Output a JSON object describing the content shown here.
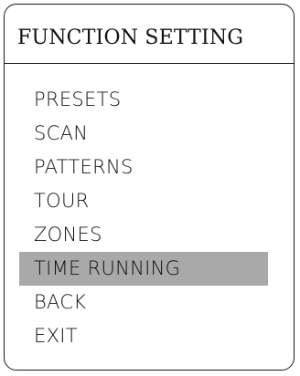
{
  "title": "FUNCTION SETTING",
  "items": [
    {
      "label": "PRESETS",
      "selected": false
    },
    {
      "label": "SCAN",
      "selected": false
    },
    {
      "label": "PATTERNS",
      "selected": false
    },
    {
      "label": "TOUR",
      "selected": false
    },
    {
      "label": "ZONES",
      "selected": false
    },
    {
      "label": "TIME RUNNING",
      "selected": true
    },
    {
      "label": "BACK",
      "selected": false
    },
    {
      "label": "EXIT",
      "selected": false
    }
  ],
  "colors": {
    "highlight": "#a9a9a9",
    "border": "#1a1a1a",
    "text": "#111111",
    "background": "#ffffff"
  }
}
